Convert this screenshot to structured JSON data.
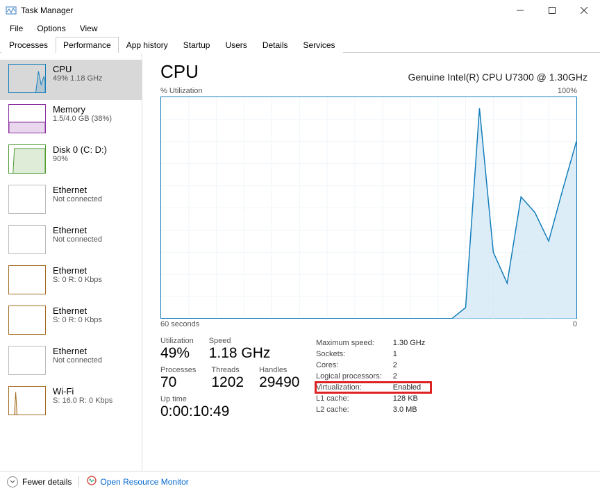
{
  "window": {
    "title": "Task Manager"
  },
  "menubar": [
    "File",
    "Options",
    "View"
  ],
  "tabs": [
    "Processes",
    "Performance",
    "App history",
    "Startup",
    "Users",
    "Details",
    "Services"
  ],
  "active_tab": "Performance",
  "sidebar": {
    "items": [
      {
        "title": "CPU",
        "sub": "49% 1.18 GHz",
        "color": "#117dbb"
      },
      {
        "title": "Memory",
        "sub": "1.5/4.0 GB (38%)",
        "color": "#8b2fa0"
      },
      {
        "title": "Disk 0 (C: D:)",
        "sub": "90%",
        "color": "#4e9a2f"
      },
      {
        "title": "Ethernet",
        "sub": "Not connected",
        "color": "#bbb"
      },
      {
        "title": "Ethernet",
        "sub": "Not connected",
        "color": "#bbb"
      },
      {
        "title": "Ethernet",
        "sub": "S: 0 R: 0 Kbps",
        "color": "#a26a1f"
      },
      {
        "title": "Ethernet",
        "sub": "S: 0 R: 0 Kbps",
        "color": "#a26a1f"
      },
      {
        "title": "Ethernet",
        "sub": "Not connected",
        "color": "#bbb"
      },
      {
        "title": "Wi-Fi",
        "sub": "S: 16.0 R: 0 Kbps",
        "color": "#a26a1f"
      }
    ],
    "active_index": 0
  },
  "main": {
    "title": "CPU",
    "subtitle": "Genuine Intel(R) CPU U7300 @ 1.30GHz",
    "chart_top_left": "% Utilization",
    "chart_top_right": "100%",
    "chart_bottom_left": "60 seconds",
    "chart_bottom_right": "0"
  },
  "stats": {
    "utilization_label": "Utilization",
    "utilization": "49%",
    "speed_label": "Speed",
    "speed": "1.18 GHz",
    "processes_label": "Processes",
    "processes": "70",
    "threads_label": "Threads",
    "threads": "1202",
    "handles_label": "Handles",
    "handles": "29490",
    "uptime_label": "Up time",
    "uptime": "0:00:10:49"
  },
  "info": [
    {
      "k": "Maximum speed:",
      "v": "1.30 GHz"
    },
    {
      "k": "Sockets:",
      "v": "1"
    },
    {
      "k": "Cores:",
      "v": "2"
    },
    {
      "k": "Logical processors:",
      "v": "2"
    },
    {
      "k": "Virtualization:",
      "v": "Enabled",
      "highlight": true
    },
    {
      "k": "L1 cache:",
      "v": "128 KB"
    },
    {
      "k": "L2 cache:",
      "v": "3.0 MB"
    }
  ],
  "footer": {
    "fewer": "Fewer details",
    "resmon": "Open Resource Monitor"
  },
  "chart_data": {
    "type": "line",
    "title": "% Utilization",
    "xlabel": "60 seconds → 0",
    "ylabel": "% Utilization",
    "ylim": [
      0,
      100
    ],
    "x": [
      60,
      58,
      56,
      54,
      52,
      50,
      48,
      46,
      44,
      42,
      40,
      38,
      36,
      34,
      32,
      30,
      28,
      26,
      24,
      22,
      20,
      18,
      16,
      14,
      12,
      10,
      8,
      6,
      4,
      2,
      0
    ],
    "values": [
      0,
      0,
      0,
      0,
      0,
      0,
      0,
      0,
      0,
      0,
      0,
      0,
      0,
      0,
      0,
      0,
      0,
      0,
      0,
      0,
      0,
      0,
      5,
      95,
      30,
      16,
      55,
      48,
      35,
      58,
      80
    ]
  }
}
